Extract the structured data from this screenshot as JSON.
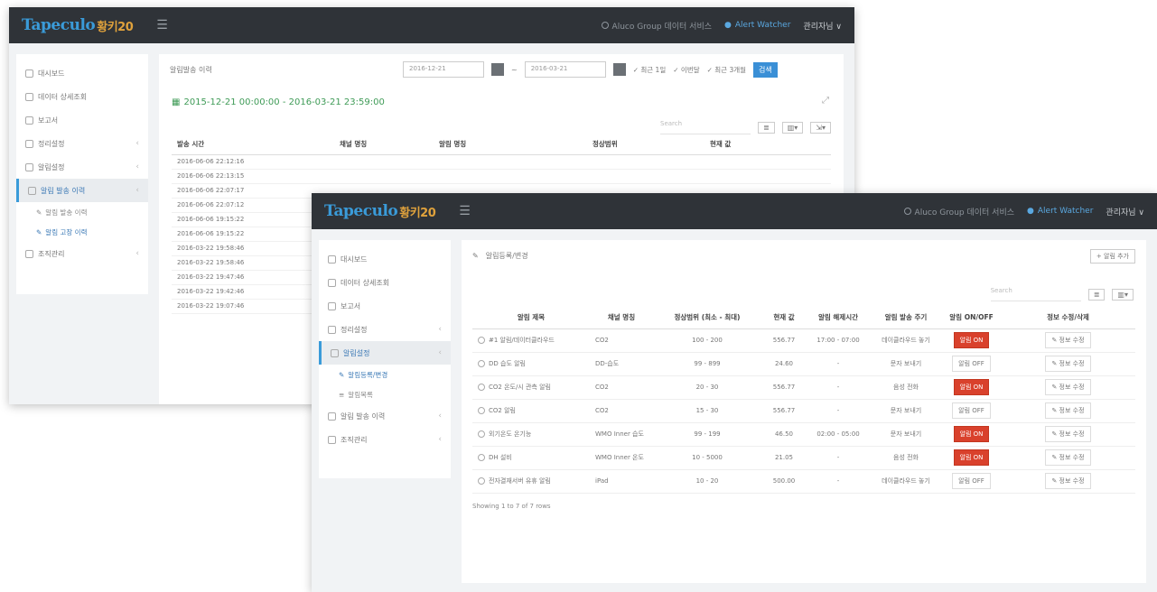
{
  "back": {
    "logo": "Tapeculo",
    "logo_suffix": "황키20",
    "topbar": {
      "item1": "Aluco Group 데이터 서비스",
      "item2": "Alert Watcher",
      "user": "관리자님 ∨"
    },
    "sidebar": {
      "items": [
        {
          "label": "대시보드"
        },
        {
          "label": "데이터 상세조회"
        },
        {
          "label": "보고서"
        },
        {
          "label": "정리설정"
        },
        {
          "label": "알림설정"
        },
        {
          "label": "알림 발송 이력",
          "active": true
        },
        {
          "label": "조직관리"
        }
      ],
      "subs": [
        {
          "label": "알림 발송 이력"
        },
        {
          "label": "알림 고장 이력",
          "active": true
        }
      ]
    },
    "header": {
      "title": "알림발송 이력",
      "date_from": "2016-12-21",
      "date_to": "2016-03-21",
      "opt1": "최근 1일",
      "opt2": "이번달",
      "opt3": "최근 3개월",
      "search_btn": "검색"
    },
    "range": "2015-12-21 00:00:00 - 2016-03-21 23:59:00",
    "search_placeholder": "Search",
    "columns": [
      "발송 시간",
      "채널 명칭",
      "알림 명칭",
      "정상범위",
      "현재 값"
    ],
    "rows": [
      [
        "2016-06-06 22:12:16"
      ],
      [
        "2016-06-06 22:13:15"
      ],
      [
        "2016-06-06 22:07:17"
      ],
      [
        "2016-06-06 22:07:12"
      ],
      [
        "2016-06-06 19:15:22"
      ],
      [
        "2016-06-06 19:15:22"
      ],
      [
        "2016-03-22 19:58:46"
      ],
      [
        "2016-03-22 19:58:46"
      ],
      [
        "2016-03-22 19:47:46"
      ],
      [
        "2016-03-22 19:42:46"
      ],
      [
        "2016-03-22 19:07:46"
      ]
    ]
  },
  "front": {
    "logo": "Tapeculo",
    "logo_suffix": "황키20",
    "topbar": {
      "item1": "Aluco Group 데이터 서비스",
      "item2": "Alert Watcher",
      "user": "관리자님 ∨"
    },
    "sidebar": {
      "items": [
        {
          "label": "대시보드"
        },
        {
          "label": "데이터 상세조회"
        },
        {
          "label": "보고서"
        },
        {
          "label": "정리설정"
        },
        {
          "label": "알림설정",
          "active": true
        }
      ],
      "subs": [
        {
          "label": "알림등록/변경",
          "active": true
        },
        {
          "label": "알림목록"
        }
      ],
      "items2": [
        {
          "label": "알림 발송 이력"
        },
        {
          "label": "조직관리"
        }
      ]
    },
    "header": {
      "title": "알림등록/변경",
      "add_btn": "+ 알림 추가"
    },
    "search_placeholder": "Search",
    "columns": [
      "알림 제목",
      "채널 명칭",
      "정상범위 (최소 - 최대)",
      "현재 값",
      "알림 해제시간",
      "알림 발송 주기",
      "알림 ON/OFF",
      "정보 수정/삭제"
    ],
    "rows": [
      {
        "title": "#1 알림/데이터클라우드",
        "channel": "CO2",
        "range": "100 - 200",
        "value": "556.77",
        "release": "17:00 - 07:00",
        "cycle": "데이클라우드 놓기",
        "status": "알림 ON",
        "on": true,
        "edit": "정보 수정"
      },
      {
        "title": "DD 습도 알림",
        "channel": "DD-습도",
        "range": "99 - 899",
        "value": "24.60",
        "release": "-",
        "cycle": "문자 보내기",
        "status": "알림 OFF",
        "on": false,
        "edit": "정보 수정"
      },
      {
        "title": "CO2 온도/시 관측 알림",
        "channel": "CO2",
        "range": "20 - 30",
        "value": "556.77",
        "release": "-",
        "cycle": "음성 전화",
        "status": "알림 ON",
        "on": true,
        "edit": "정보 수정"
      },
      {
        "title": "CO2 알림",
        "channel": "CO2",
        "range": "15 - 30",
        "value": "556.77",
        "release": "-",
        "cycle": "문자 보내기",
        "status": "알림 OFF",
        "on": false,
        "edit": "정보 수정"
      },
      {
        "title": "외기온도 온기능",
        "channel": "WMO Inner 습도",
        "range": "99 - 199",
        "value": "46.50",
        "release": "02:00 - 05:00",
        "cycle": "문자 보내기",
        "status": "알림 ON",
        "on": true,
        "edit": "정보 수정"
      },
      {
        "title": "DH 설비",
        "channel": "WMO Inner 온도",
        "range": "10 - 5000",
        "value": "21.05",
        "release": "-",
        "cycle": "음성 전화",
        "status": "알림 ON",
        "on": true,
        "edit": "정보 수정"
      },
      {
        "title": "전자결재서버 유휴 알림",
        "channel": "iPad",
        "range": "10 - 20",
        "value": "500.00",
        "release": "-",
        "cycle": "데이클라우드 놓기",
        "status": "알림 OFF",
        "on": false,
        "edit": "정보 수정"
      }
    ],
    "showing": "Showing 1 to 7 of 7 rows"
  },
  "colors": {
    "accent": "#3a8fd6",
    "topbar": "#2f3338",
    "on": "#d9412c",
    "range": "#3f9b57"
  }
}
